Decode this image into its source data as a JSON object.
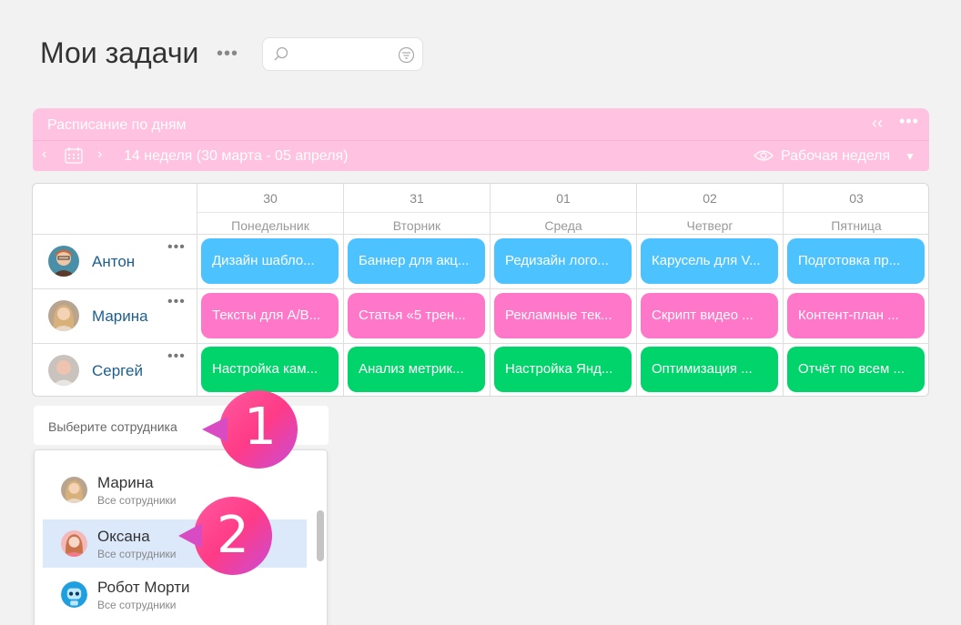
{
  "page": {
    "title": "Мои задачи"
  },
  "search": {
    "placeholder": ""
  },
  "schedule": {
    "title": "Расписание по дням",
    "week_label": "14 неделя (30 марта - 05 апреля)",
    "view_mode": "Рабочая неделя",
    "color": "#ffc2e0"
  },
  "days": [
    {
      "date": "30",
      "weekday": "Понедельник"
    },
    {
      "date": "31",
      "weekday": "Вторник"
    },
    {
      "date": "01",
      "weekday": "Среда"
    },
    {
      "date": "02",
      "weekday": "Четверг"
    },
    {
      "date": "03",
      "weekday": "Пятница"
    }
  ],
  "people": [
    {
      "name": "Антон",
      "color": "#4cc3ff",
      "tasks": [
        "Дизайн шабло...",
        "Баннер для акц...",
        "Редизайн лого...",
        "Карусель для V...",
        "Подготовка пр..."
      ]
    },
    {
      "name": "Марина",
      "color": "#ff77c8",
      "tasks": [
        "Тексты для A/B...",
        "Статья «5 трен...",
        "Рекламные тек...",
        "Скрипт видео ...",
        "Контент-план ..."
      ]
    },
    {
      "name": "Сергей",
      "color": "#00d46a",
      "tasks": [
        "Настройка кам...",
        "Анализ метрик...",
        "Настройка Янд...",
        "Оптимизация ...",
        "Отчёт по всем ..."
      ]
    }
  ],
  "employee_select": {
    "placeholder": "Выберите сотрудника",
    "options": [
      {
        "name": "Марина",
        "group": "Все сотрудники"
      },
      {
        "name": "Оксана",
        "group": "Все сотрудники"
      },
      {
        "name": "Робот Морти",
        "group": "Все сотрудники"
      }
    ]
  },
  "badges": {
    "first": "1",
    "second": "2"
  }
}
